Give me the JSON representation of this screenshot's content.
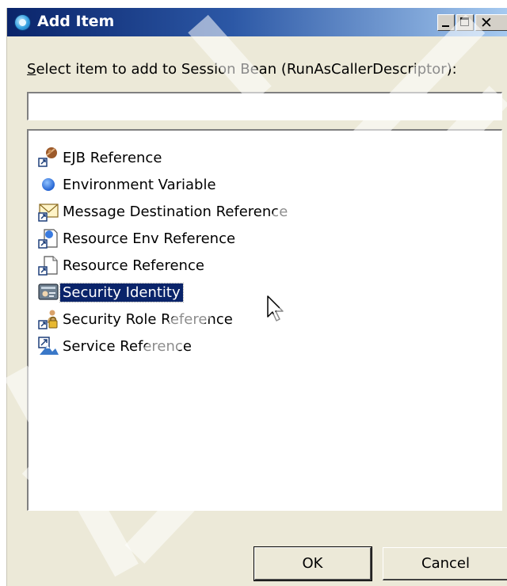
{
  "window": {
    "title": "Add Item",
    "controls": [
      "minimize",
      "maximize",
      "close"
    ]
  },
  "prompt": {
    "mnemonic": "S",
    "rest": "elect item to add to Session Bean (RunAsCallerDescriptor):"
  },
  "filter": {
    "value": "",
    "placeholder": ""
  },
  "items": [
    {
      "label": "EJB Reference",
      "icon": "ejb-reference-icon"
    },
    {
      "label": "Environment Variable",
      "icon": "environment-variable-icon"
    },
    {
      "label": "Message Destination Reference",
      "icon": "message-destination-icon"
    },
    {
      "label": "Resource Env Reference",
      "icon": "resource-env-icon"
    },
    {
      "label": "Resource Reference",
      "icon": "resource-reference-icon"
    },
    {
      "label": "Security Identity",
      "icon": "security-identity-icon",
      "selected": true
    },
    {
      "label": "Security Role Reference",
      "icon": "security-role-icon"
    },
    {
      "label": "Service Reference",
      "icon": "service-reference-icon"
    }
  ],
  "buttons": {
    "ok": "OK",
    "cancel": "Cancel"
  },
  "colors": {
    "titlebar_start": "#0a246a",
    "titlebar_end": "#a6caf0",
    "dialog_bg": "#ece9d8",
    "selection": "#0a246a"
  }
}
